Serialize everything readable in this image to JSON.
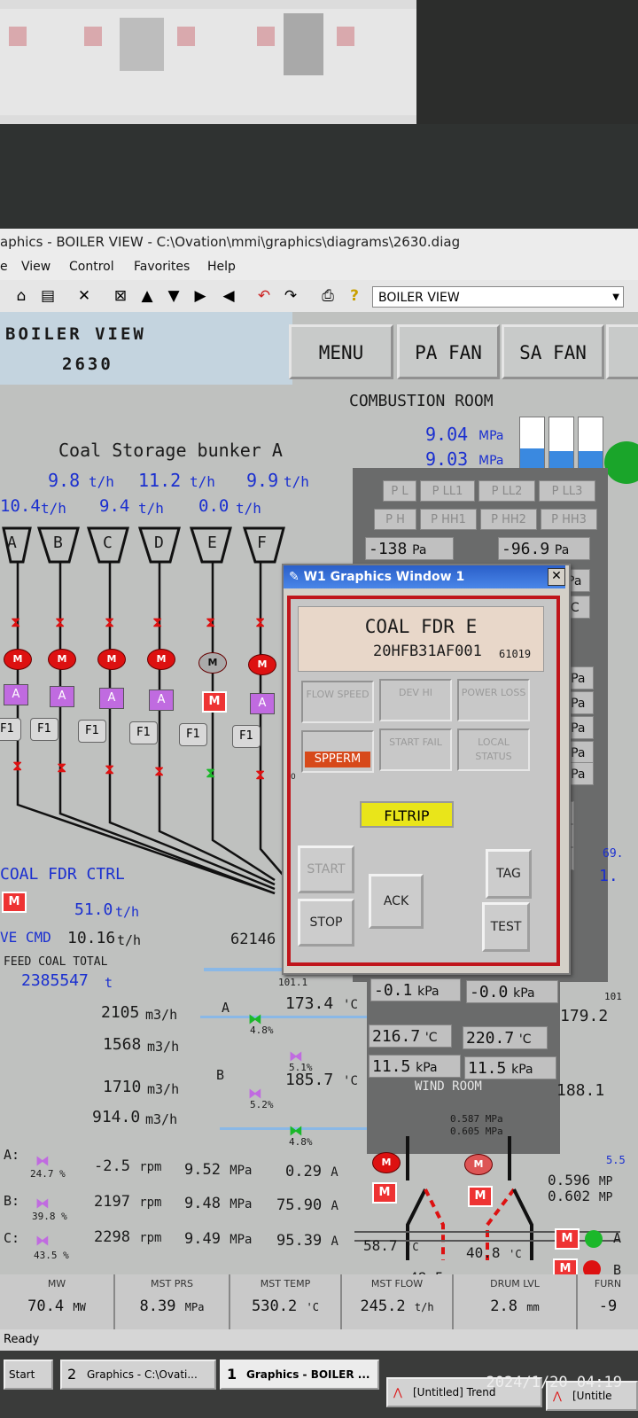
{
  "window": {
    "title": "aphics - BOILER VIEW - C:\\Ovation\\mmi\\graphics\\diagrams\\2630.diag"
  },
  "menu": [
    "e",
    "View",
    "Control",
    "Favorites",
    "Help"
  ],
  "toolbar": {
    "view_select": "BOILER VIEW"
  },
  "header": {
    "title": "BOILER VIEW",
    "number": "2630"
  },
  "nav": [
    "MENU",
    "PA FAN",
    "SA FAN"
  ],
  "combustion": {
    "label": "COMBUSTION ROOM",
    "p1": "9.04",
    "p2": "9.03",
    "unit": "MPa",
    "lamps1": [
      "P L",
      "P LL1",
      "P LL2",
      "P LL3"
    ],
    "lamps2": [
      "P H",
      "P HH1",
      "P HH2",
      "P HH3"
    ],
    "v1": "-138",
    "v1u": "Pa",
    "v2": "-96.9",
    "v2u": "Pa",
    "gauge_levels": [
      0.45,
      0.4,
      0.4
    ]
  },
  "bunker": {
    "label": "Coal Storage bunker A",
    "rates_row1": [
      "9.8",
      "11.2",
      "9.9"
    ],
    "rates_row2": [
      "10.4",
      "9.4",
      "0.0"
    ],
    "unit": "t/h",
    "units": [
      "A",
      "B",
      "C",
      "D",
      "E",
      "F"
    ],
    "f1": "F1",
    "m": "M",
    "a": "A"
  },
  "coal_ctrl": {
    "label": "COAL FDR CTRL",
    "rate": "51.0",
    "cmd_label": "VE CMD",
    "cmd": "10.16",
    "unit": "t/h",
    "code": "62146",
    "total_label": "FEED COAL TOTAL",
    "total": "2385547",
    "total_unit": "t"
  },
  "flows": [
    {
      "v": "2105",
      "u": "m3/h"
    },
    {
      "v": "1568",
      "u": "m3/h"
    },
    {
      "v": "1710",
      "u": "m3/h"
    },
    {
      "v": "914.0",
      "u": "m3/h"
    }
  ],
  "dampers": {
    "a_label": "A",
    "b_label": "B",
    "a_pct": "4.8",
    "b_pct": "5.1",
    "c_pct": "5.2",
    "d_pct": "4.8",
    "pct_unit": "%",
    "t1": "173.4",
    "t2": "185.7",
    "t_unit": "'C",
    "top_pct": "101.1"
  },
  "mills": [
    {
      "label": "A:",
      "pct": "24.7",
      "rpm": "-2.5",
      "mpa": "9.52",
      "amp": "0.29"
    },
    {
      "label": "B:",
      "pct": "39.8",
      "rpm": "2197",
      "mpa": "9.48",
      "amp": "75.90"
    },
    {
      "label": "C:",
      "pct": "43.5",
      "rpm": "2298",
      "mpa": "9.49",
      "amp": "95.39"
    }
  ],
  "mill_units": {
    "rpm": "rpm",
    "mpa": "MPa",
    "amp": "A"
  },
  "windroom": {
    "label": "WIND ROOM",
    "k1": "-0.1",
    "k2": "-0.0",
    "t1": "216.7",
    "t2": "220.7",
    "p1": "11.5",
    "p2": "11.5",
    "kpa": "kPa",
    "deg": "'C",
    "r1": "179.2",
    "r2": "188.1",
    "r3": "101",
    "small1": "0.587",
    "small2": "0.605",
    "small_u": "MPa",
    "out1": "0.596",
    "out2": "0.602",
    "out_u": "MP",
    "temp1": "58.7",
    "temp2": "40.8",
    "temp3": "48.5"
  },
  "right": {
    "kpa_labels": [
      "kPa",
      "kPa",
      "kPa",
      "kPa",
      "kPa"
    ],
    "c_labels": [
      "C",
      "C",
      "C",
      "C",
      "C",
      "C"
    ],
    "val1": "69.",
    "val2": "1.",
    "val3": "5.5",
    "side_a": "A",
    "side_b": "B"
  },
  "status": [
    {
      "label": "MW",
      "value": "70.4",
      "unit": "MW"
    },
    {
      "label": "MST PRS",
      "value": "8.39",
      "unit": "MPa"
    },
    {
      "label": "MST TEMP",
      "value": "530.2",
      "unit": "'C"
    },
    {
      "label": "MST FLOW",
      "value": "245.2",
      "unit": "t/h"
    },
    {
      "label": "DRUM LVL",
      "value": "2.8",
      "unit": "mm"
    },
    {
      "label": "FURN",
      "value": "-9",
      "unit": ""
    }
  ],
  "ready": "Ready",
  "taskbar": [
    "Start",
    "Graphics - C:\\Ovati...",
    "Graphics - BOILER ...",
    "[Untitled] Trend",
    "[Untitle"
  ],
  "task_nums": [
    "2",
    "1"
  ],
  "clock": "2024/1/20 04:19",
  "dialog": {
    "title": "W1 Graphics Window 1",
    "name": "COAL FDR E",
    "tag": "20HFB31AF001",
    "code": "61019",
    "tiles": [
      "FLOW SPEED",
      "DEV HI",
      "POWER LOSS",
      "",
      "START FAIL",
      "LOCAL STATUS"
    ],
    "spperm": "SPPERM",
    "fltrip": "FLTRIP",
    "zero": "0",
    "buttons": {
      "start": "START",
      "stop": "STOP",
      "ack": "ACK",
      "tag": "TAG",
      "test": "TEST"
    }
  }
}
